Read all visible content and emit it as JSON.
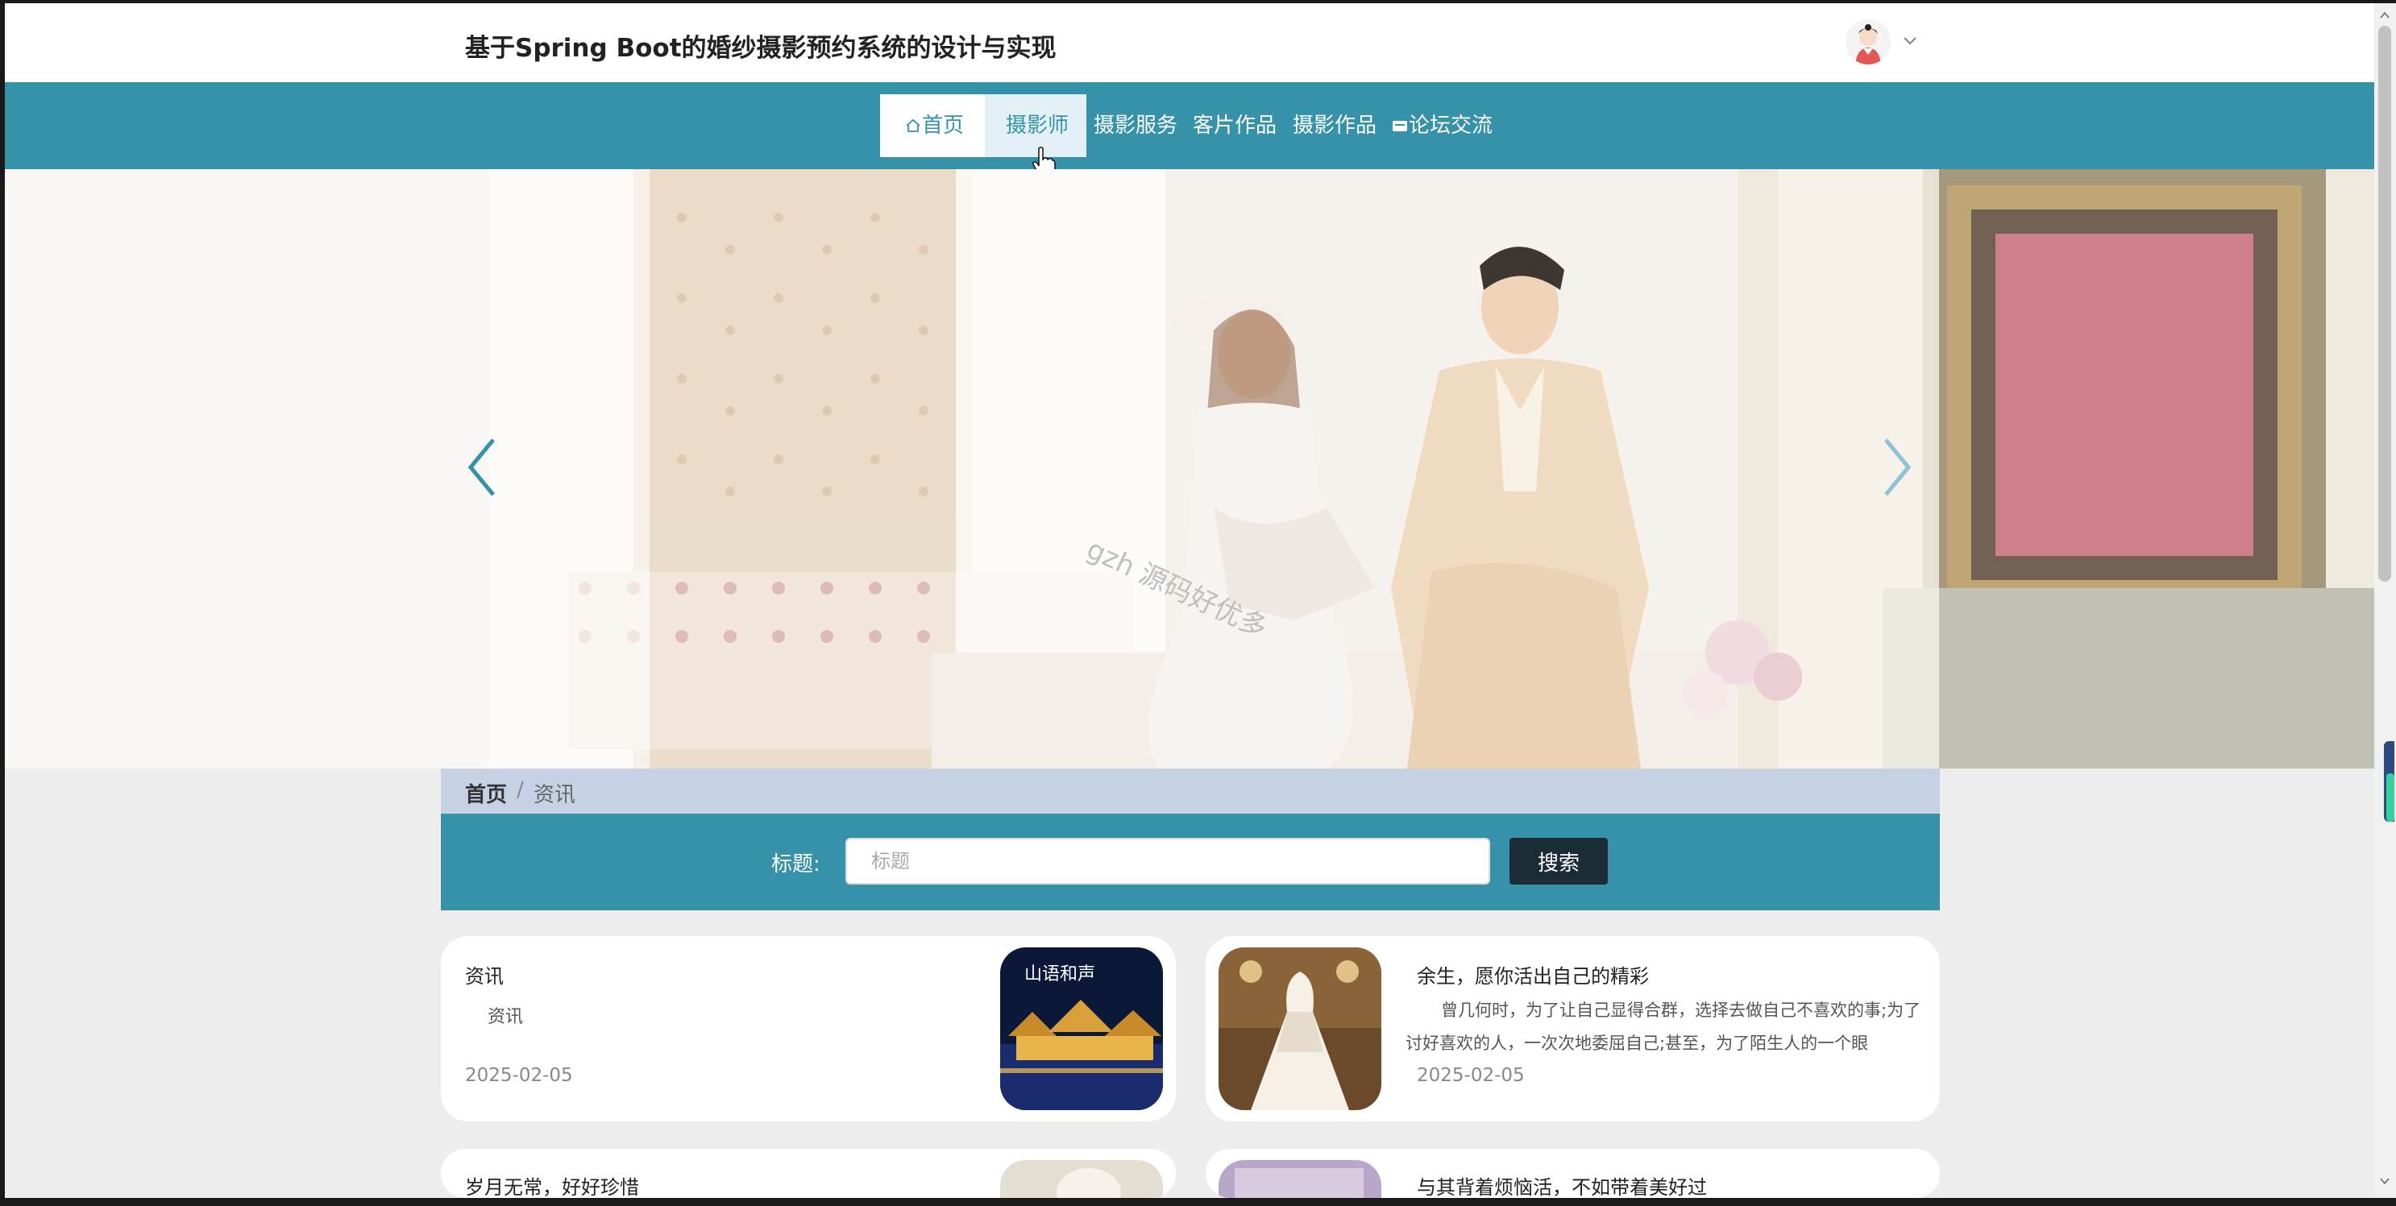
{
  "header": {
    "title": "基于Spring Boot的婚纱摄影预约系统的设计与实现"
  },
  "nav": {
    "items": [
      {
        "label": "首页",
        "icon": "home-icon"
      },
      {
        "label": "摄影师"
      },
      {
        "label": "摄影服务"
      },
      {
        "label": "客片作品"
      },
      {
        "label": "摄影作品"
      },
      {
        "label": "论坛交流",
        "icon": "forum-icon"
      }
    ]
  },
  "banner": {
    "watermark": "gzh 源码好优多"
  },
  "breadcrumb": {
    "home": "首页",
    "separator": "/",
    "current": "资讯"
  },
  "search": {
    "label": "标题:",
    "placeholder": "标题",
    "button": "搜索"
  },
  "news": [
    {
      "title": "资讯",
      "summary": "资讯",
      "date": "2025-02-05"
    },
    {
      "title": "余生，愿你活出自己的精彩",
      "summary": "曾几何时，为了让自己显得合群，选择去做自己不喜欢的事;为了讨好喜欢的人，一次次地委屈自己;甚至，为了陌生人的一个眼",
      "date": "2025-02-05"
    },
    {
      "title": "岁月无常，好好珍惜"
    },
    {
      "title": "与其背着烦恼活，不如带着美好过"
    }
  ],
  "colors": {
    "primary": "#3592a8",
    "breadcrumb_bg": "#c6d2e3",
    "button_dark": "#1c2c36"
  }
}
